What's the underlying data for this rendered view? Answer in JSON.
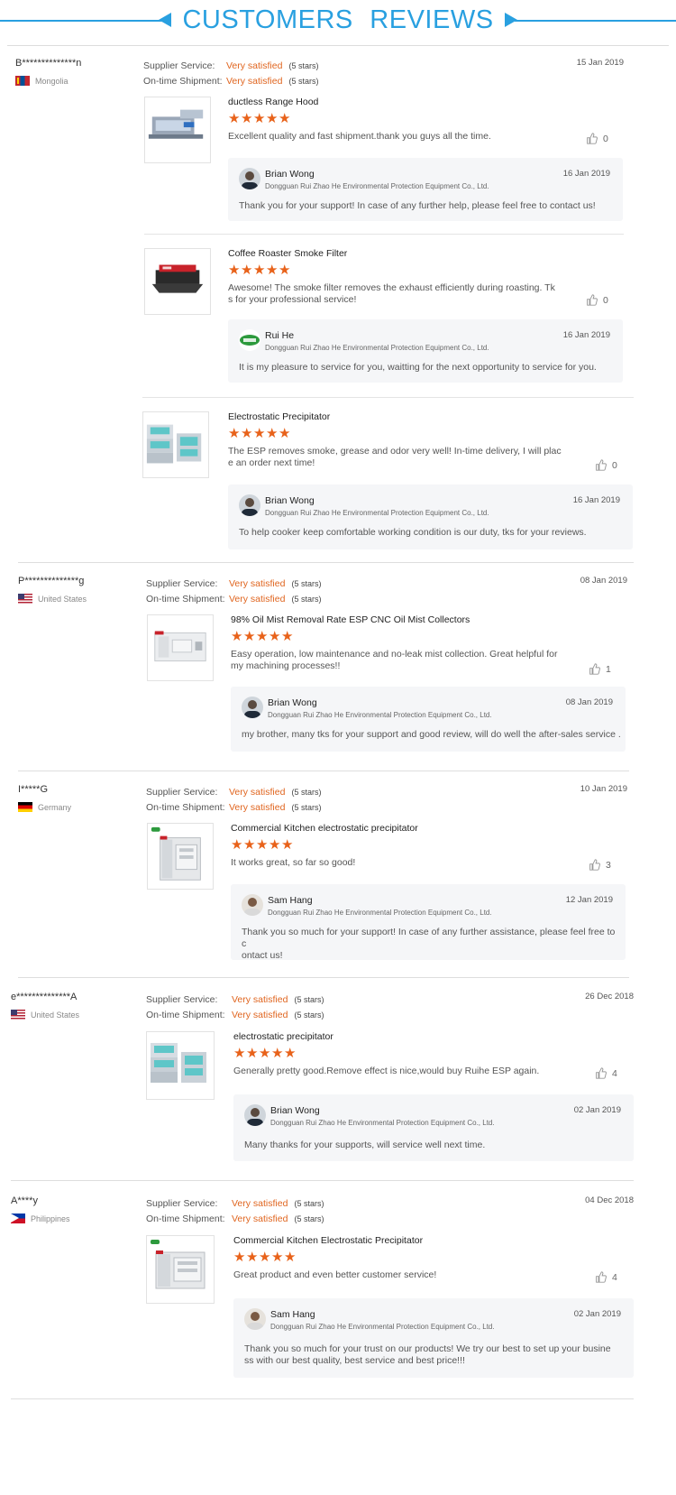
{
  "header": {
    "title": "CUSTOMERS   REVIEWS"
  },
  "labels": {
    "supplier_service": "Supplier Service:",
    "ontime_shipment": "On-time Shipment:"
  },
  "colors": {
    "accent": "#29a0e0",
    "rating": "#e0651f",
    "star": "#e8621a"
  },
  "reviews": [
    {
      "buyer": "B**************n",
      "country": "Mongolia",
      "flag": "mn",
      "date": "15 Jan 2019",
      "supplier_service": "Very satisfied",
      "supplier_stars": "(5 stars)",
      "shipment": "Very satisfied",
      "shipment_stars": "(5 stars)",
      "products": [
        {
          "title": "ductless Range Hood",
          "rating": 5,
          "comment": "Excellent quality and fast shipment.thank you guys all the time.",
          "likes": "0",
          "reply": {
            "name": "Brian Wong",
            "company": "Dongguan Rui Zhao He Environmental Protection Equipment Co., Ltd.",
            "date": "16 Jan 2019",
            "text": "Thank you  for your support! In case of any further help, please feel free to contact us!"
          }
        },
        {
          "title": "Coffee Roaster Smoke Filter",
          "rating": 5,
          "comment": "Awesome! The smoke filter removes the exhaust efficiently during roasting. Tk\ns for your professional service!",
          "likes": "0",
          "reply": {
            "name": "Rui He",
            "company": "Dongguan Rui Zhao He Environmental Protection Equipment Co., Ltd.",
            "date": "16 Jan 2019",
            "text": "It is my pleasure to service for you, waitting for the next opportunity to service for you."
          }
        },
        {
          "title": "Electrostatic Precipitator",
          "rating": 5,
          "comment": "The ESP removes smoke, grease and odor very well!  In-time delivery, I will plac\ne an order next time!",
          "likes": "0",
          "reply": {
            "name": "Brian Wong",
            "company": "Dongguan Rui Zhao He Environmental Protection Equipment Co., Ltd.",
            "date": "16 Jan 2019",
            "text": "To help cooker keep comfortable  working condition is our duty, tks for your reviews."
          }
        }
      ]
    },
    {
      "buyer": "P**************g",
      "country": "United States",
      "flag": "us",
      "date": "08 Jan 2019",
      "supplier_service": "Very satisfied",
      "supplier_stars": "(5 stars)",
      "shipment": "Very satisfied",
      "shipment_stars": "(5 stars)",
      "products": [
        {
          "title": "98% Oil Mist Removal Rate ESP CNC Oil Mist Collectors",
          "rating": 5,
          "comment": "Easy operation, low maintenance and no-leak mist collection. Great helpful for\nmy machining processes!!",
          "likes": "1",
          "reply": {
            "name": "Brian Wong",
            "company": "Dongguan Rui Zhao He Environmental Protection Equipment Co., Ltd.",
            "date": "08 Jan 2019",
            "text": "my brother, many tks for your support and good review, will do well the after-sales service ."
          }
        }
      ]
    },
    {
      "buyer": "I*****G",
      "country": "Germany",
      "flag": "de",
      "date": "10 Jan 2019",
      "supplier_service": "Very satisfied",
      "supplier_stars": "(5 stars)",
      "shipment": "Very satisfied",
      "shipment_stars": "(5 stars)",
      "products": [
        {
          "title": "Commercial Kitchen electrostatic precipitator",
          "rating": 5,
          "comment": "It works great, so far so good!",
          "likes": "3",
          "reply": {
            "name": "Sam Hang",
            "company": "Dongguan Rui Zhao He Environmental Protection Equipment Co., Ltd.",
            "date": "12 Jan 2019",
            "text": "Thank you so much for your support! In case of any further assistance, please feel free to c\nontact us!"
          }
        }
      ]
    },
    {
      "buyer": "e**************A",
      "country": "United States",
      "flag": "us",
      "date": "26 Dec 2018",
      "supplier_service": "Very satisfied",
      "supplier_stars": "(5 stars)",
      "shipment": "Very satisfied",
      "shipment_stars": "(5 stars)",
      "products": [
        {
          "title": "electrostatic precipitator",
          "rating": 5,
          "comment": "Generally pretty good.Remove effect is nice,would buy Ruihe ESP again.",
          "likes": "4",
          "reply": {
            "name": "Brian Wong",
            "company": "Dongguan Rui Zhao He Environmental Protection Equipment Co., Ltd.",
            "date": "02 Jan 2019",
            "text": "Many thanks for your supports, will service well next time."
          }
        }
      ]
    },
    {
      "buyer": "A****y",
      "country": "Philippines",
      "flag": "ph",
      "date": "04 Dec 2018",
      "supplier_service": "Very satisfied",
      "supplier_stars": "(5 stars)",
      "shipment": "Very satisfied",
      "shipment_stars": "(5 stars)",
      "products": [
        {
          "title": "Commercial Kitchen Electrostatic Precipitator",
          "rating": 5,
          "comment": "Great product and even better customer service!",
          "likes": "4",
          "reply": {
            "name": "Sam Hang",
            "company": "Dongguan Rui Zhao He Environmental Protection Equipment Co., Ltd.",
            "date": "02 Jan 2019",
            "text": "Thank you so much for your trust on our products! We try our best to set up your busine\nss with our best quality, best service and best price!!!"
          }
        }
      ]
    }
  ]
}
